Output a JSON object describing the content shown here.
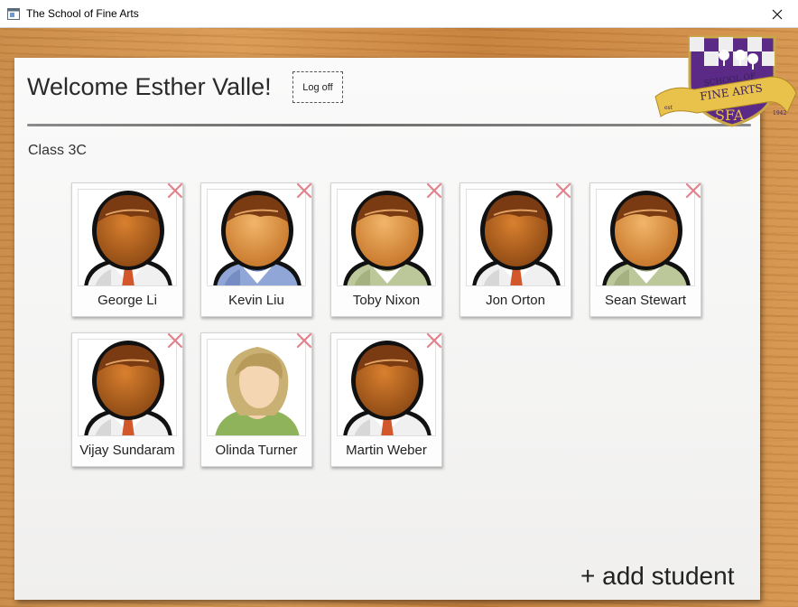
{
  "window": {
    "title": "The School of Fine Arts"
  },
  "header": {
    "welcome": "Welcome Esther Valle!",
    "logoff_label": "Log off"
  },
  "class": {
    "label": "Class 3C"
  },
  "students": [
    {
      "name": "George Li",
      "avatar": "male-avatar-darkskin-white-shirt"
    },
    {
      "name": "Kevin Liu",
      "avatar": "male-avatar-lightskin-blue-sweater"
    },
    {
      "name": "Toby Nixon",
      "avatar": "male-avatar-lightskin-green-shirt"
    },
    {
      "name": "Jon Orton",
      "avatar": "male-avatar-darkskin-white-shirt"
    },
    {
      "name": "Sean Stewart",
      "avatar": "male-avatar-lightskin-green-shirt"
    },
    {
      "name": "Vijay Sundaram",
      "avatar": "male-avatar-darkskin-white-shirt"
    },
    {
      "name": "Olinda Turner",
      "avatar": "female-avatar-blonde-green-top"
    },
    {
      "name": "Martin Weber",
      "avatar": "male-avatar-darkskin-white-shirt"
    }
  ],
  "actions": {
    "add_student": "+ add student"
  },
  "crest": {
    "text_top": "SCHOOL OF",
    "text_middle": "FINE ARTS",
    "text_bottom": "SFA",
    "ribbon_left": "est",
    "ribbon_right": "1942"
  },
  "colors": {
    "crest_purple": "#5a2a86",
    "ribbon_gold": "#e8c24a",
    "remove_mark": "#e06d7a"
  }
}
